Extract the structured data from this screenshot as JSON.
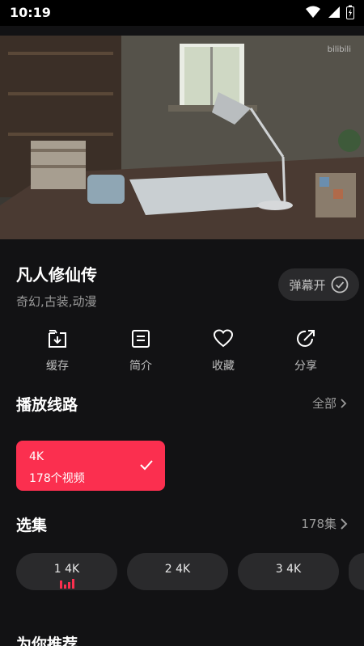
{
  "status": {
    "time": "10:19"
  },
  "video": {
    "watermark": "bilibili"
  },
  "show": {
    "title": "凡人修仙传",
    "tags": "奇幻,古装,动漫",
    "danmaku_label": "弹幕开"
  },
  "actions": [
    {
      "label": "缓存",
      "icon": "download-icon"
    },
    {
      "label": "简介",
      "icon": "document-icon"
    },
    {
      "label": "收藏",
      "icon": "heart-icon"
    },
    {
      "label": "分享",
      "icon": "share-icon"
    }
  ],
  "routes": {
    "title": "播放线路",
    "link": "全部",
    "selected": {
      "name": "4K",
      "count": "178个视频"
    }
  },
  "episodes": {
    "title": "选集",
    "link": "178集",
    "items": [
      {
        "label": "1 4K"
      },
      {
        "label": "2 4K"
      },
      {
        "label": "3 4K"
      }
    ]
  },
  "recommend": {
    "title": "为你推荐"
  },
  "colors": {
    "accent": "#fb2f4f",
    "background": "#121214",
    "chip": "#2a2a2c"
  }
}
